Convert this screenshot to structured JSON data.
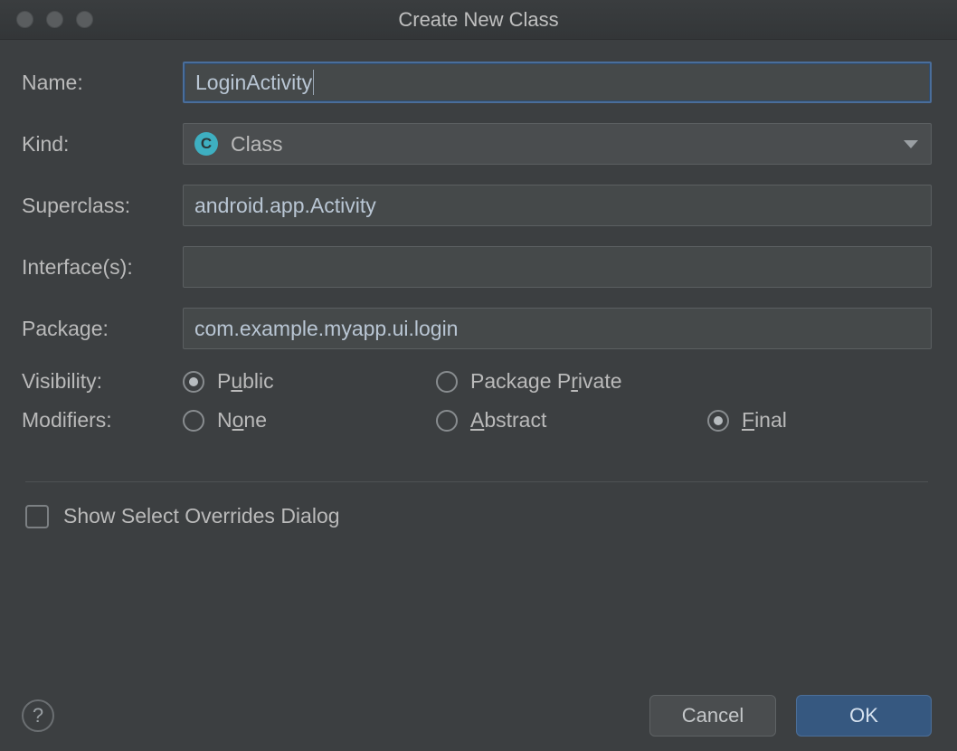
{
  "title": "Create New Class",
  "labels": {
    "name": "Name:",
    "kind": "Kind:",
    "superclass": "Superclass:",
    "interfaces": "Interface(s):",
    "package": "Package:",
    "visibility": "Visibility:",
    "modifiers": "Modifiers:"
  },
  "fields": {
    "name": "LoginActivity",
    "kind": "Class",
    "superclass": "android.app.Activity",
    "interfaces": "",
    "package": "com.example.myapp.ui.login"
  },
  "visibility_options": {
    "public": {
      "pre": "P",
      "mn": "u",
      "post": "blic",
      "selected": true
    },
    "package_private": {
      "pre": "Package P",
      "mn": "r",
      "post": "ivate",
      "selected": false
    }
  },
  "modifier_options": {
    "none": {
      "pre": "N",
      "mn": "o",
      "post": "ne",
      "selected": false
    },
    "abstract": {
      "pre": "",
      "mn": "A",
      "post": "bstract",
      "selected": false
    },
    "final": {
      "pre": "",
      "mn": "F",
      "post": "inal",
      "selected": true
    }
  },
  "checkbox": {
    "label": "Show Select Overrides Dialog",
    "checked": false
  },
  "buttons": {
    "cancel": "Cancel",
    "ok": "OK"
  },
  "help_glyph": "?",
  "kind_icon_letter": "C"
}
